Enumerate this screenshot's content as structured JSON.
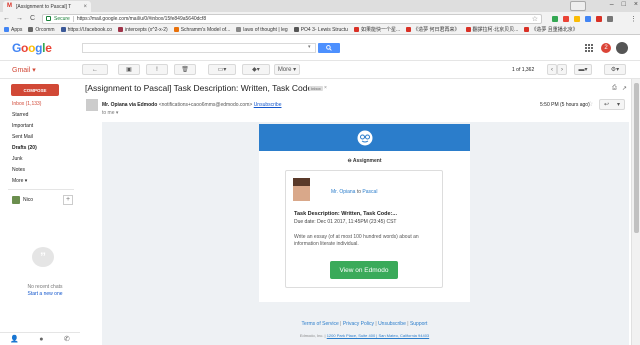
{
  "browser": {
    "tab_title": "[Assignment to Pascal] T",
    "tab_close": "×",
    "url": "https://mail.google.com/mail/u/0/#inbox/15fe849a5640dcf8",
    "secure_label": "Secure",
    "back": "←",
    "forward": "→",
    "reload": "C",
    "star": "☆",
    "menu": "⋮",
    "window_controls": [
      "–",
      "□",
      "×"
    ],
    "bookmarks": [
      "Apps",
      "Orcomm",
      "https://l.facebook.co",
      "intercepts (x^2-x-2)",
      "Schramm's Model of...",
      "laws of thought | leg",
      "PO4 3- Lewis Structu",
      "如果能快一个星...",
      "《造夢 何日君再来》",
      "翻譯拉柯·北京贝贝...",
      "《造夢 且重播北京》"
    ]
  },
  "gmail": {
    "logo_letters": [
      "G",
      "o",
      "o",
      "g",
      "l",
      "e"
    ],
    "logo_colors": [
      "#4285f4",
      "#ea4335",
      "#fbbc05",
      "#4285f4",
      "#34a853",
      "#ea4335"
    ],
    "search_caret": "▾",
    "notification_count": "2",
    "label": "Gmail ▾",
    "pager": "1 of 1,362",
    "more_label": "More ▾",
    "action_icons": [
      "←",
      "▣",
      "!",
      "🗑",
      "▭▾",
      "◆▾"
    ],
    "nav_arrows": [
      "‹",
      "›"
    ],
    "view_btn": "▬▾",
    "settings_btn": "⚙▾"
  },
  "sidebar": {
    "compose": "COMPOSE",
    "items": [
      "Inbox (1,133)",
      "Starred",
      "Important",
      "Sent Mail",
      "Drafts (20)",
      "Junk",
      "Notes",
      "More ▾"
    ],
    "user": "Nico",
    "add": "+",
    "no_chats": "No recent chats",
    "start_new": "Start a new one",
    "chat_icon_glyph": "”",
    "footer_icons": [
      "👤",
      "●",
      "✆"
    ]
  },
  "message": {
    "subject": "[Assignment to Pascal] Task Description: Written, Task Code:...",
    "label": "Inbox",
    "label_close": "×",
    "print_icon": "⎙",
    "newwin_icon": "↗",
    "sender_name": "Mr. Opiana via Edmodo",
    "sender_email": "<notifications+caoo6mms@edmodo.com>",
    "unsubscribe": "Unsubscribe",
    "to": "to me ▾",
    "time": "5:50 PM (5 hours ago)",
    "star": "☆",
    "reply": "↩",
    "reply_more": "▾"
  },
  "edmodo": {
    "header": "Assignment",
    "from_name": "Mr. Opiana",
    "to_word": " to ",
    "to_name": "Pascal",
    "task_title": "Task Description: Written, Task Code:...",
    "due": "Due date: Dec 01 2017, 11:45PM (23:45) CST",
    "description": "Write an essay (of at most 100 hundred words) about an information literate individual.",
    "button": "View on Edmodo",
    "footer_links": [
      "Terms of Service",
      "Privacy Policy",
      "Unsubscribe",
      "Support"
    ],
    "footer_sep": " | ",
    "footer_company": "Edmodo, Inc. | ",
    "footer_address": "1200 Park Place, Suite 400 | San Mateo, California 94403",
    "brand_color": "#2b7dcb",
    "button_color": "#3aaa5a"
  }
}
